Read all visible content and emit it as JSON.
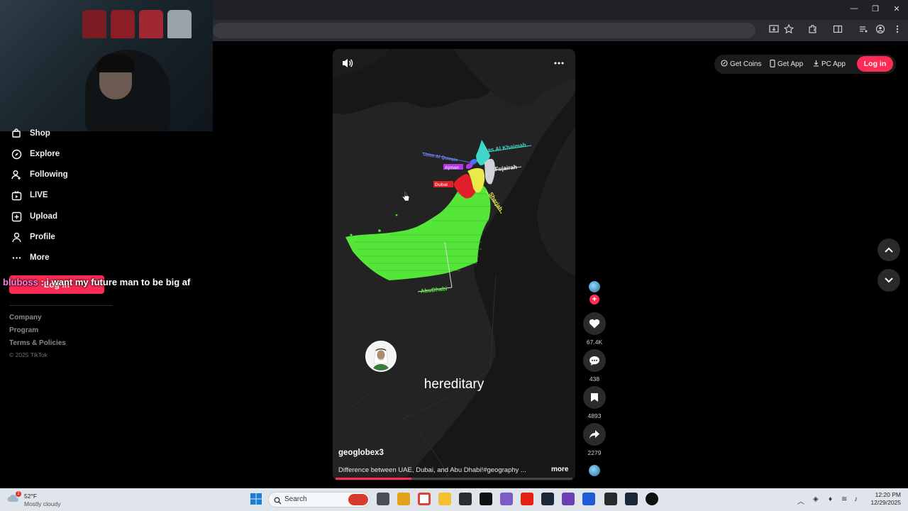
{
  "browser": {
    "window_controls": [
      "—",
      "❐",
      "✕"
    ]
  },
  "sidebar": {
    "items": [
      {
        "label": "Shop",
        "icon": "shop-icon"
      },
      {
        "label": "Explore",
        "icon": "compass-icon"
      },
      {
        "label": "Following",
        "icon": "user-icon"
      },
      {
        "label": "LIVE",
        "icon": "live-tv-icon"
      },
      {
        "label": "Upload",
        "icon": "plus-square-icon"
      },
      {
        "label": "Profile",
        "icon": "person-icon"
      },
      {
        "label": "More",
        "icon": "ellipsis-icon"
      }
    ],
    "login_label": "Log in",
    "footer_links": [
      "Company",
      "Program",
      "Terms & Policies"
    ],
    "copyright": "© 2025 TikTok"
  },
  "stream_overlay": {
    "chat_user": "bluboss",
    "chat_message": " : i want my future man to be big af"
  },
  "video": {
    "caption_word": "hereditary",
    "author": "geoglobex3",
    "description": "Difference between UAE, Dubai, and Abu Dhabi!#geography ...",
    "more_label": "more",
    "progress": 0.32,
    "map_labels": {
      "ras_al_khaimah": "Ras Al Khaimah",
      "fujairah": "Fujairah",
      "umm_al_quwain": "Umm Al Quwain",
      "ajman": "Ajman",
      "dubai": "Dubai",
      "sharjah": "Sharjah",
      "abu_dhabi": "AbuDhabi"
    }
  },
  "actions": {
    "likes": "67.4K",
    "comments": "438",
    "saves": "4893",
    "shares": "2279"
  },
  "top_actions": {
    "get_coins": "Get Coins",
    "get_app": "Get App",
    "pc_app": "PC App",
    "login": "Log in"
  },
  "taskbar": {
    "temperature": "52°F",
    "weather": "Mostly cloudy",
    "search_placeholder": "Search",
    "time": "12:20 PM",
    "date": "12/29/2025"
  },
  "colors": {
    "accent": "#fe2c55",
    "abu_dhabi": "#55e63a",
    "dubai": "#e01f2a",
    "sharjah": "#e9e94a",
    "fujairah": "#cfd2d6",
    "ras_al_khaimah": "#3fd7c9",
    "umm_al_quwain": "#4d6ff2",
    "ajman": "#b535e8"
  }
}
